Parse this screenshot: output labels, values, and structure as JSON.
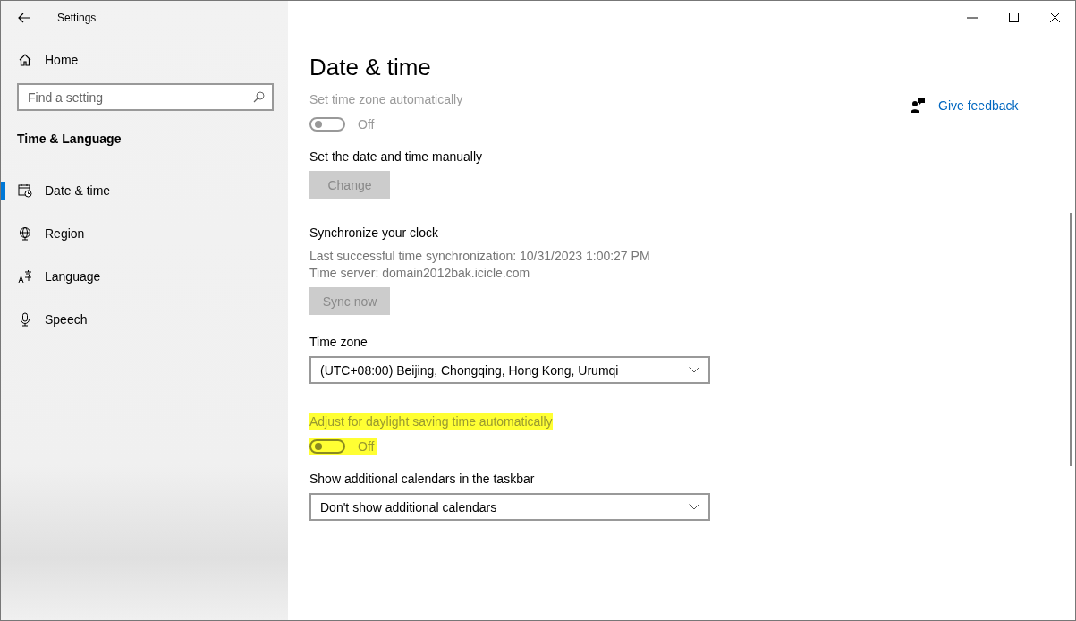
{
  "window": {
    "title": "Settings"
  },
  "sidebar": {
    "home": "Home",
    "search": {
      "placeholder": "Find a setting"
    },
    "section": "Time & Language",
    "items": [
      {
        "label": "Date & time",
        "selected": true
      },
      {
        "label": "Region",
        "selected": false
      },
      {
        "label": "Language",
        "selected": false
      },
      {
        "label": "Speech",
        "selected": false
      }
    ]
  },
  "page": {
    "title": "Date & time",
    "settings": [
      {
        "kind": "toggle",
        "label": "Set time zone automatically",
        "on": false,
        "disabled": true,
        "highlighted": false,
        "state_text": "Off"
      },
      {
        "kind": "button",
        "label": "Set the date and time manually",
        "button": "Change",
        "disabled": true
      },
      {
        "kind": "info",
        "label": "Synchronize your clock",
        "lines": [
          "Last successful time synchronization: 10/31/2023 1:00:27 PM",
          "Time server: domain2012bak.icicle.com"
        ],
        "button": "Sync now",
        "disabled": true
      },
      {
        "kind": "dropdown",
        "label": "Time zone",
        "value": "(UTC+08:00) Beijing, Chongqing, Hong Kong, Urumqi"
      },
      {
        "kind": "toggle",
        "label": "Adjust for daylight saving time automatically",
        "on": false,
        "disabled": true,
        "highlighted": true,
        "state_text": "Off"
      },
      {
        "kind": "dropdown",
        "label": "Show additional calendars in the taskbar",
        "value": "Don't show additional calendars"
      }
    ]
  },
  "feedback": "Give feedback"
}
